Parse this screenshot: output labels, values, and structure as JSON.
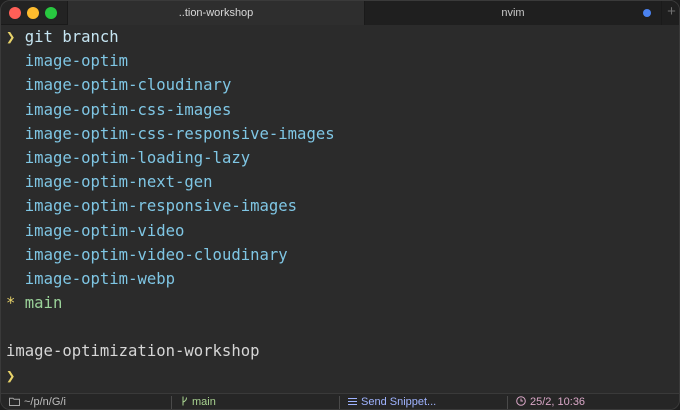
{
  "tabs": [
    {
      "label": "..tion-workshop",
      "active": true
    },
    {
      "label": "nvim",
      "active": false,
      "modified": true
    }
  ],
  "new_tab_symbol": "+",
  "terminal": {
    "prompt_symbol": "❯",
    "command": "git branch",
    "branches": [
      "image-optim",
      "image-optim-cloudinary",
      "image-optim-css-images",
      "image-optim-css-responsive-images",
      "image-optim-loading-lazy",
      "image-optim-next-gen",
      "image-optim-responsive-images",
      "image-optim-video",
      "image-optim-video-cloudinary",
      "image-optim-webp"
    ],
    "current_branch_marker": "*",
    "current_branch": "main",
    "directory": "image-optimization-workshop",
    "second_prompt_symbol": "❯"
  },
  "statusbar": {
    "path_icon": "folder-icon",
    "path": "~/p/n/G/i",
    "branch_icon": "git-branch-icon",
    "branch": "main",
    "snippet_icon": "list-icon",
    "snippet": "Send Snippet...",
    "position_icon": "clock-icon",
    "position": "25/2, 10:36"
  },
  "colors": {
    "background": "#2b2b2b",
    "branch_text": "#7fc6e4",
    "prompt": "#e8d36a",
    "current_branch": "#9bd39a",
    "tab_dot": "#4a82f0"
  }
}
